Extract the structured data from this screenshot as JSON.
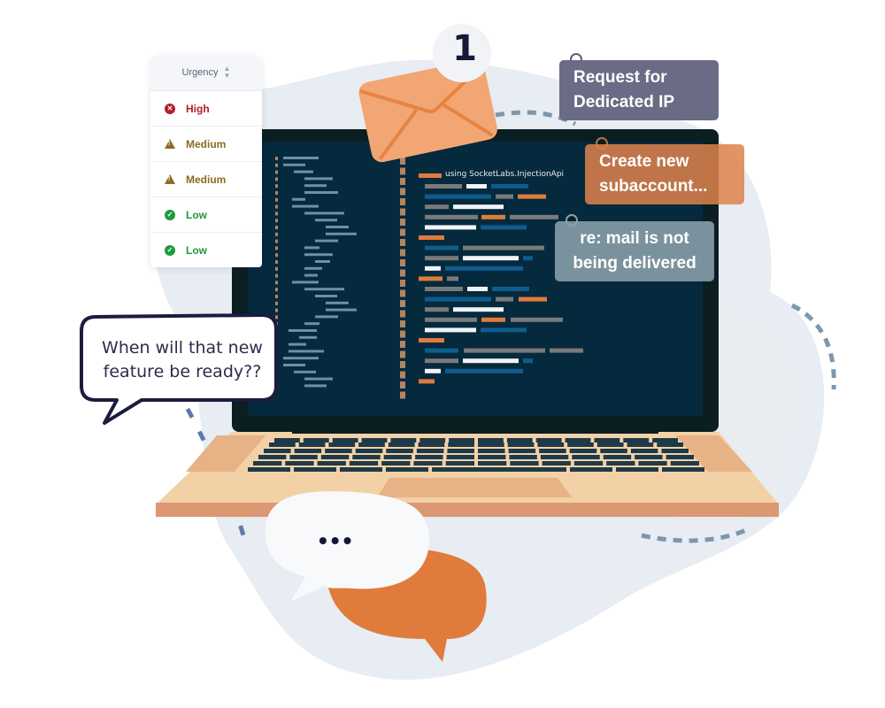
{
  "urgency_table": {
    "header": "Urgency",
    "sort_icon": "sort-icon",
    "rows": [
      {
        "label": "High",
        "icon": "error-circle-icon",
        "color": "#b0202d"
      },
      {
        "label": "Medium",
        "icon": "warning-triangle-icon",
        "color": "#8a6d1f"
      },
      {
        "label": "Medium",
        "icon": "warning-triangle-icon",
        "color": "#8a6d1f"
      },
      {
        "label": "Low",
        "icon": "check-circle-icon",
        "color": "#1f9a3e"
      },
      {
        "label": "Low",
        "icon": "check-circle-icon",
        "color": "#1f9a3e"
      }
    ]
  },
  "mail_notification": {
    "icon": "envelope-icon",
    "badge_count": "1"
  },
  "tags": {
    "dedicated_ip": "Request for Dedicated IP",
    "subaccount": "Create new subaccount...",
    "mail_issue": "re: mail is not being delivered"
  },
  "code_editor": {
    "visible_code_text": "using SocketLabs.InjectionApi"
  },
  "speech_bubble": {
    "text": "When will that new feature be ready??"
  },
  "typing_bubble": {
    "text": "•••"
  },
  "colors": {
    "orange_accent": "#e07b3c",
    "envelope": "#f2a673",
    "screen": "#05293d",
    "bezel": "#0b1e22",
    "laptop_body": "#f3d1a6",
    "laptop_edge": "#dc9872",
    "blob": "#e8ecf3",
    "dash": "#7d97ad",
    "ink": "#1a1b3e"
  }
}
